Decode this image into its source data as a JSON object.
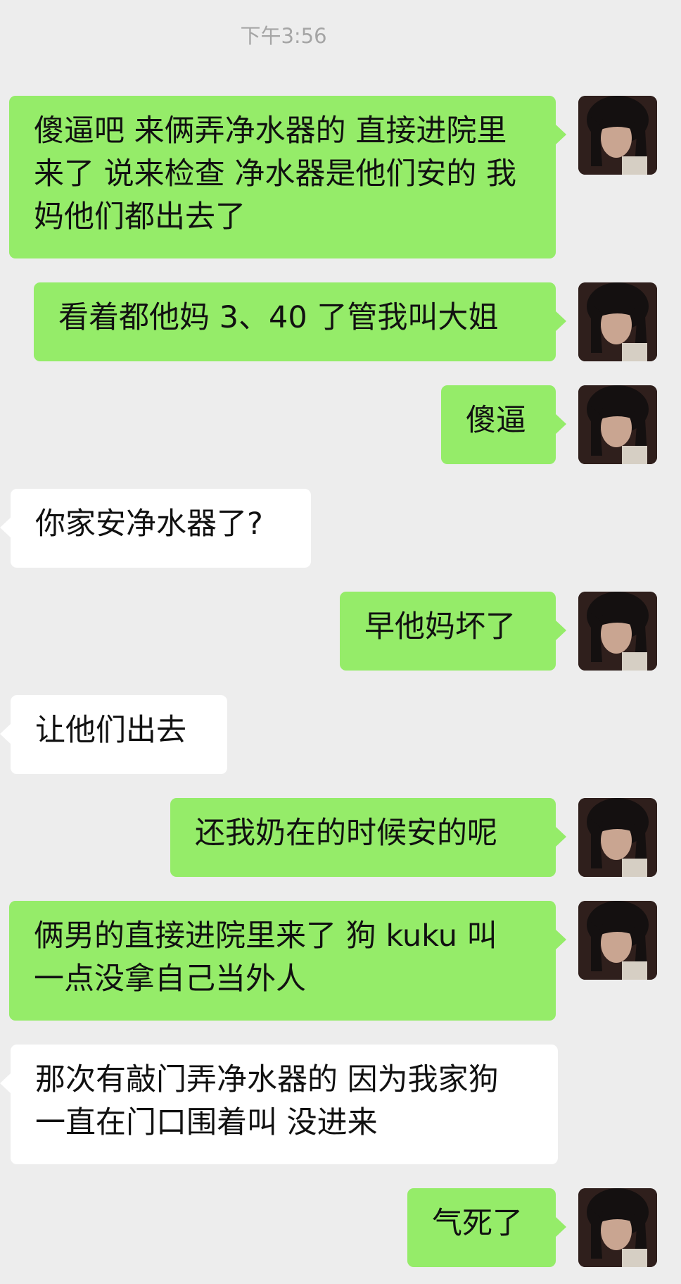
{
  "chat": {
    "timestamp": "下午3:56",
    "messages": [
      {
        "sender": "me",
        "text": "傻逼吧 来俩弄净水器的 直接进院里来了 说来检查 净水器是他们安的 我妈他们都出去了"
      },
      {
        "sender": "me",
        "text": "看着都他妈 3、40 了管我叫大姐"
      },
      {
        "sender": "me",
        "text": "傻逼"
      },
      {
        "sender": "them",
        "text": "你家安净水器了?"
      },
      {
        "sender": "me",
        "text": "早他妈坏了"
      },
      {
        "sender": "them",
        "text": "让他们出去"
      },
      {
        "sender": "me",
        "text": "还我奶在的时候安的呢"
      },
      {
        "sender": "me",
        "text": "俩男的直接进院里来了 狗 kuku 叫 一点没拿自己当外人"
      },
      {
        "sender": "them",
        "text": "那次有敲门弄净水器的 因为我家狗 一直在门口围着叫 没进来"
      },
      {
        "sender": "me",
        "text": "气死了"
      }
    ]
  },
  "colors": {
    "background": "#ededed",
    "my_bubble": "#95ec69",
    "their_bubble": "#ffffff",
    "timestamp": "#a5a5a5"
  },
  "icons": {
    "avatar": "user-avatar-photo"
  }
}
